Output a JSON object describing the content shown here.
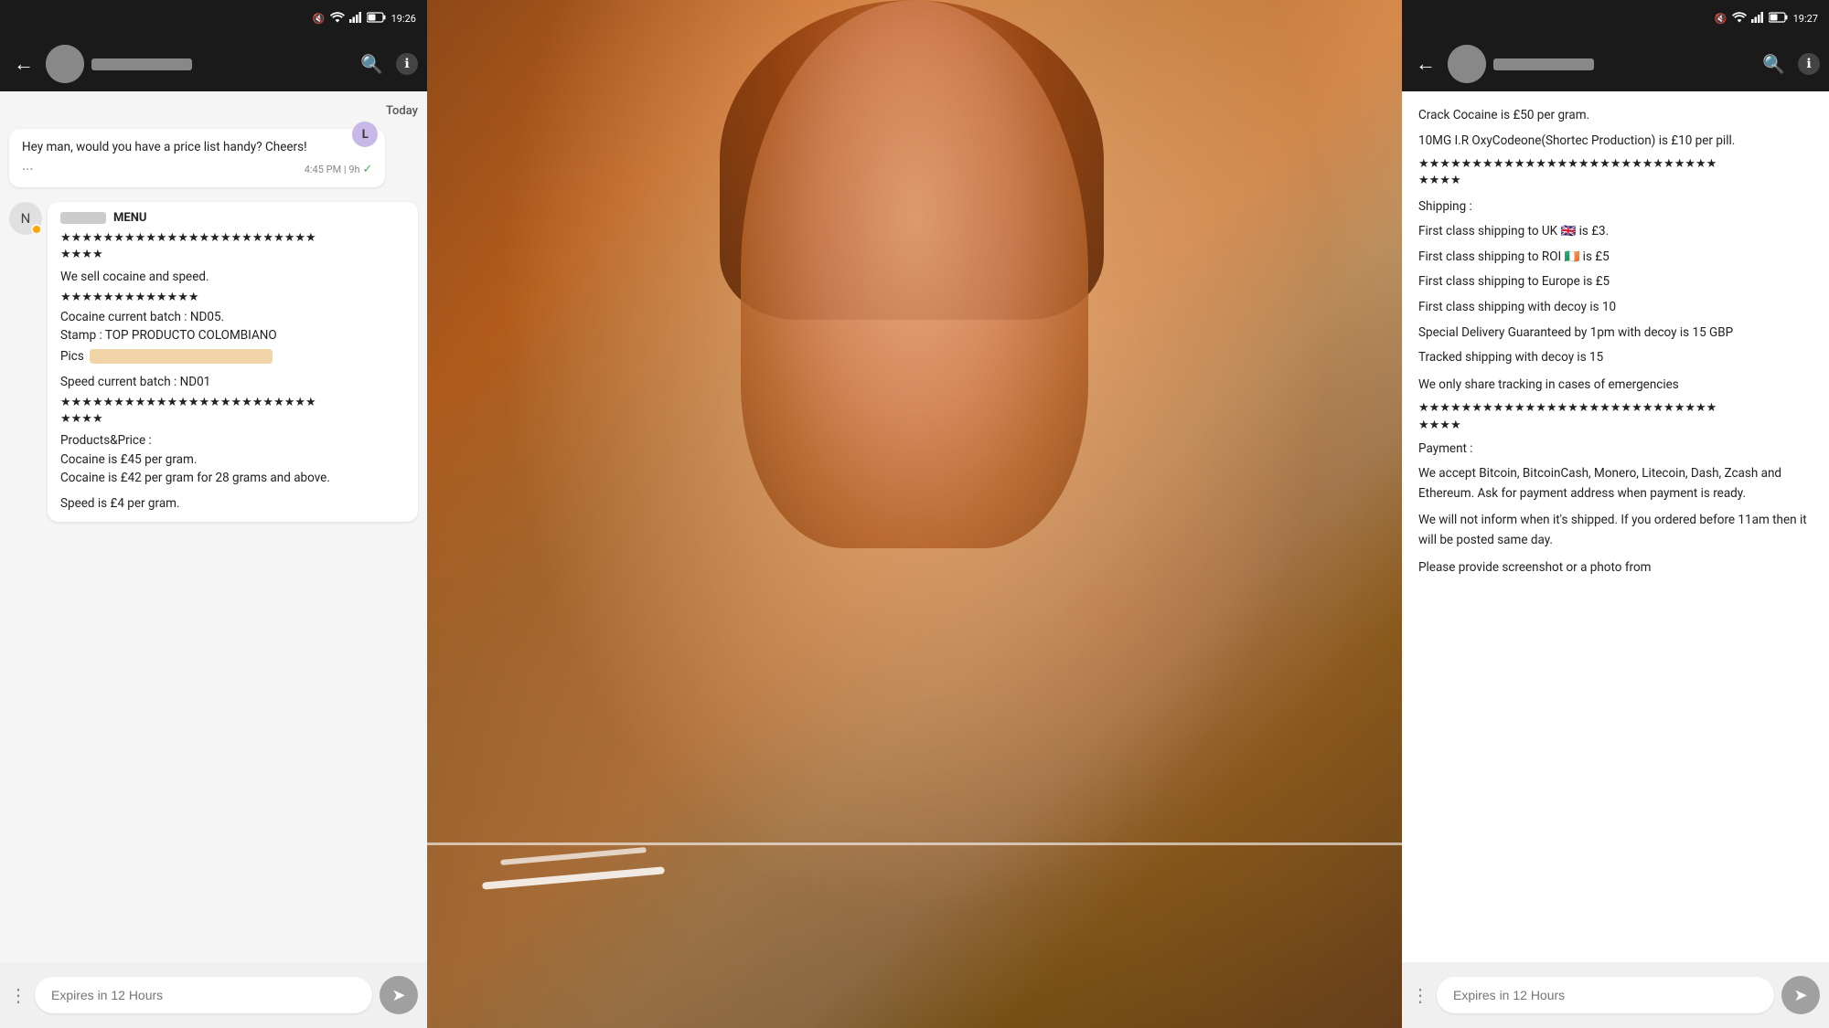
{
  "left_panel": {
    "status_bar": {
      "mute_icon": "🔇",
      "wifi_icon": "📶",
      "signal_icon": "📶",
      "battery": "42%",
      "time": "19:26"
    },
    "app_bar": {
      "back_label": "←",
      "search_label": "🔍",
      "info_label": "ℹ"
    },
    "chat": {
      "date_label": "Today",
      "message1": {
        "sender_initial": "L",
        "text": "Hey man, would you have a price list handy? Cheers!",
        "time": "4:45 PM",
        "hours_ago": "9h",
        "check": "✓"
      },
      "message2": {
        "sender_initial": "N",
        "has_orange_dot": true,
        "name_label": "MENU",
        "stars1": "★★★★★★★★★★★★★★★★★★★★★★★★",
        "text1": "We sell cocaine and speed.",
        "stars2": "★★★★★★★★★★★★★",
        "batch_cocaine": "Cocaine current batch : ND05.",
        "stamp": "Stamp : TOP PRODUCTO COLOMBIANO",
        "pics_label": "Pics",
        "speed_batch": "Speed current batch : ND01",
        "stars3": "★★★★★★★★★★★★★★★★★★★★★★★★",
        "products_price": "Products&Price :",
        "price1": "Cocaine is £45 per gram.",
        "price2": "Cocaine is £42 per gram for 28 grams and above.",
        "price3": "Speed is £4 per gram."
      }
    },
    "bottom_bar": {
      "input_placeholder": "Expires in 12 Hours",
      "send_icon": "➤"
    }
  },
  "right_panel": {
    "status_bar": {
      "mute_icon": "🔇",
      "wifi_icon": "📶",
      "signal_icon": "📶",
      "battery": "42%",
      "time": "19:27"
    },
    "app_bar": {
      "back_label": "←",
      "search_label": "🔍",
      "info_label": "ℹ"
    },
    "content": {
      "line1": "Crack Cocaine is £50 per gram.",
      "line2": "10MG I.R OxyCodeone(Shortec Production) is £10 per pill.",
      "stars1": "★★★★★★★★★★★★★★★★★★★★★★★★★★★★",
      "shipping_label": "Shipping :",
      "ship1": "First class shipping to UK 🇬🇧 is £3.",
      "ship2": "First class shipping to ROI 🇮🇪 is £5",
      "ship3": "First class shipping to Europe is £5",
      "ship4": "First class shipping with decoy is 10",
      "ship5": "Special Delivery Guaranteed by 1pm with decoy  is 15 GBP",
      "ship6": "Tracked shipping with decoy is 15",
      "tracking_note": "We only share tracking in cases of emergencies",
      "stars2": "★★★★★★★★★★★★★★★★★★★★★★★★★★★★",
      "payment_label": "Payment :",
      "payment_text": "We accept Bitcoin, BitcoinCash, Monero, Litecoin, Dash, Zcash and Ethereum. Ask for payment address when payment is ready.",
      "shipping_note": "We will not inform when it's shipped. If you ordered before 11am then it will be posted same day.",
      "screenshot_note": "Please provide screenshot or a photo from"
    },
    "bottom_bar": {
      "input_placeholder": "Expires in 12 Hours",
      "send_icon": "➤"
    }
  }
}
